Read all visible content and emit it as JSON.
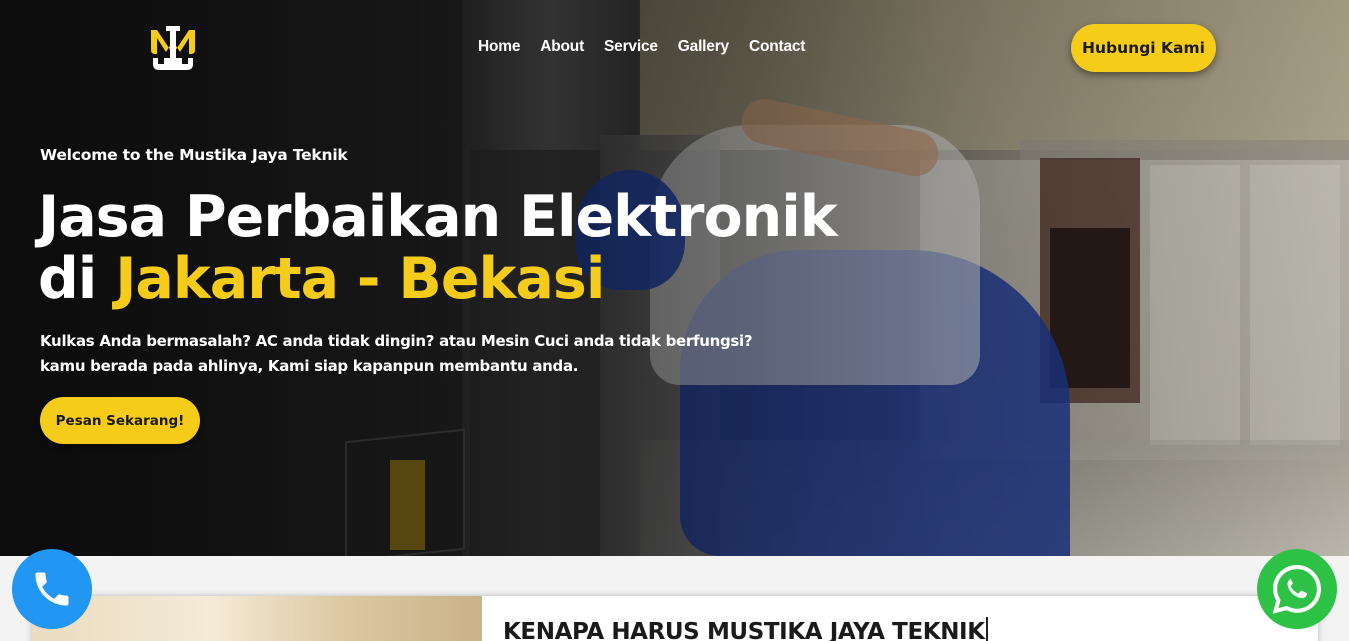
{
  "brand": {
    "logo_icon": "mjt-monogram-icon",
    "accent_color": "#f6cc1b"
  },
  "nav": {
    "items": [
      {
        "label": "Home"
      },
      {
        "label": "About"
      },
      {
        "label": "Service"
      },
      {
        "label": "Gallery"
      },
      {
        "label": "Contact"
      }
    ],
    "cta_label": "Hubungi Kami"
  },
  "hero": {
    "welcome": "Welcome to the Mustika Jaya Teknik",
    "headline_line1": "Jasa Perbaikan Elektronik",
    "headline_line2_prefix": "di",
    "headline_line2_highlight": "Jakarta - Bekasi",
    "desc_line1": "Kulkas Anda bermasalah? AC anda tidak dingin? atau Mesin Cuci anda tidak berfungsi?",
    "desc_line2": "kamu berada pada ahlinya, Kami siap kapanpun membantu anda.",
    "cta_label": "Pesan Sekarang!"
  },
  "section": {
    "title": "KENAPA HARUS MUSTIKA JAYA TEKNIK"
  },
  "floating": {
    "phone_icon": "phone-icon",
    "phone_color": "#2196f3",
    "whatsapp_icon": "whatsapp-icon",
    "whatsapp_color": "#2dc246"
  }
}
